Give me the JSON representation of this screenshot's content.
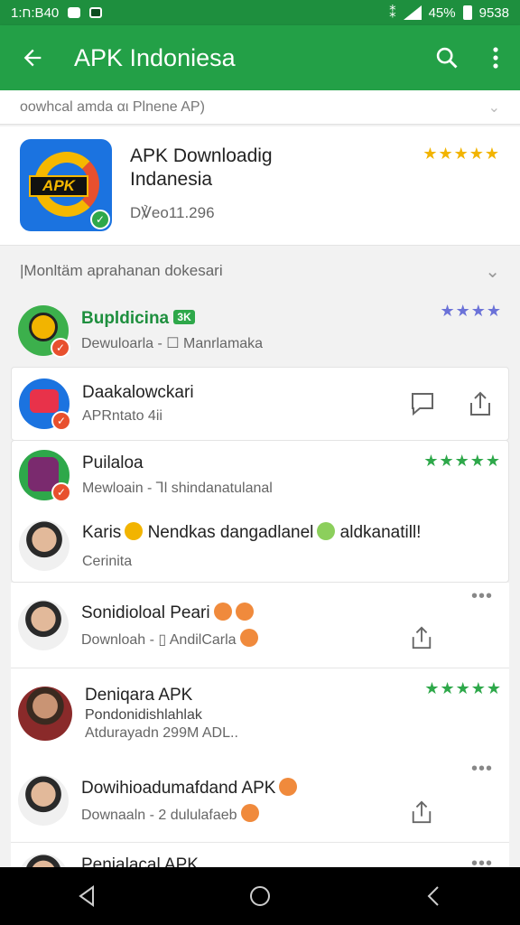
{
  "status_bar": {
    "time_left": "ח:1:B40",
    "battery": "45%",
    "clock": "9538"
  },
  "toolbar": {
    "title": "APK Indoniesa"
  },
  "strip": {
    "text": "oowhcal amda αι Plnene AP)"
  },
  "featured": {
    "name": "APK Downloadig Indanesia",
    "sub": "D℣eo11.296",
    "stars": "★★★★★",
    "icon_label": "APK"
  },
  "section": {
    "title": "|Monltäm aprahanan dokesari"
  },
  "rows": [
    {
      "title": "Bupldicina",
      "badge": "3K",
      "sub": "Dewuloarla - ☐ Manrlamaka",
      "stars": "★★★★"
    },
    {
      "title": "Daakalowckari",
      "sub": "APRntato 4ii"
    },
    {
      "title": "Puilaloa",
      "sub": "Mewloain - Ꞁl shindanatulanal",
      "stars": "★★★★★"
    },
    {
      "title": "Karis",
      "title_rest": "Nendkas dangadlanel",
      "title_end": "aldkanatill!",
      "sub": "Cerinita"
    },
    {
      "title": "Sonidioloal Peari",
      "sub": "Downloah - ▯ AndilCarla"
    },
    {
      "title": "Deniqara APK",
      "sub": "Pondonidishlahlak",
      "sub2": "Atdurayadn  299M ADL..",
      "stars": "★★★★★"
    },
    {
      "title": "Dowihioadumafdand APK",
      "sub": "Downaaln - 2 dululafaeb"
    },
    {
      "title": "Penialacal APK"
    }
  ]
}
